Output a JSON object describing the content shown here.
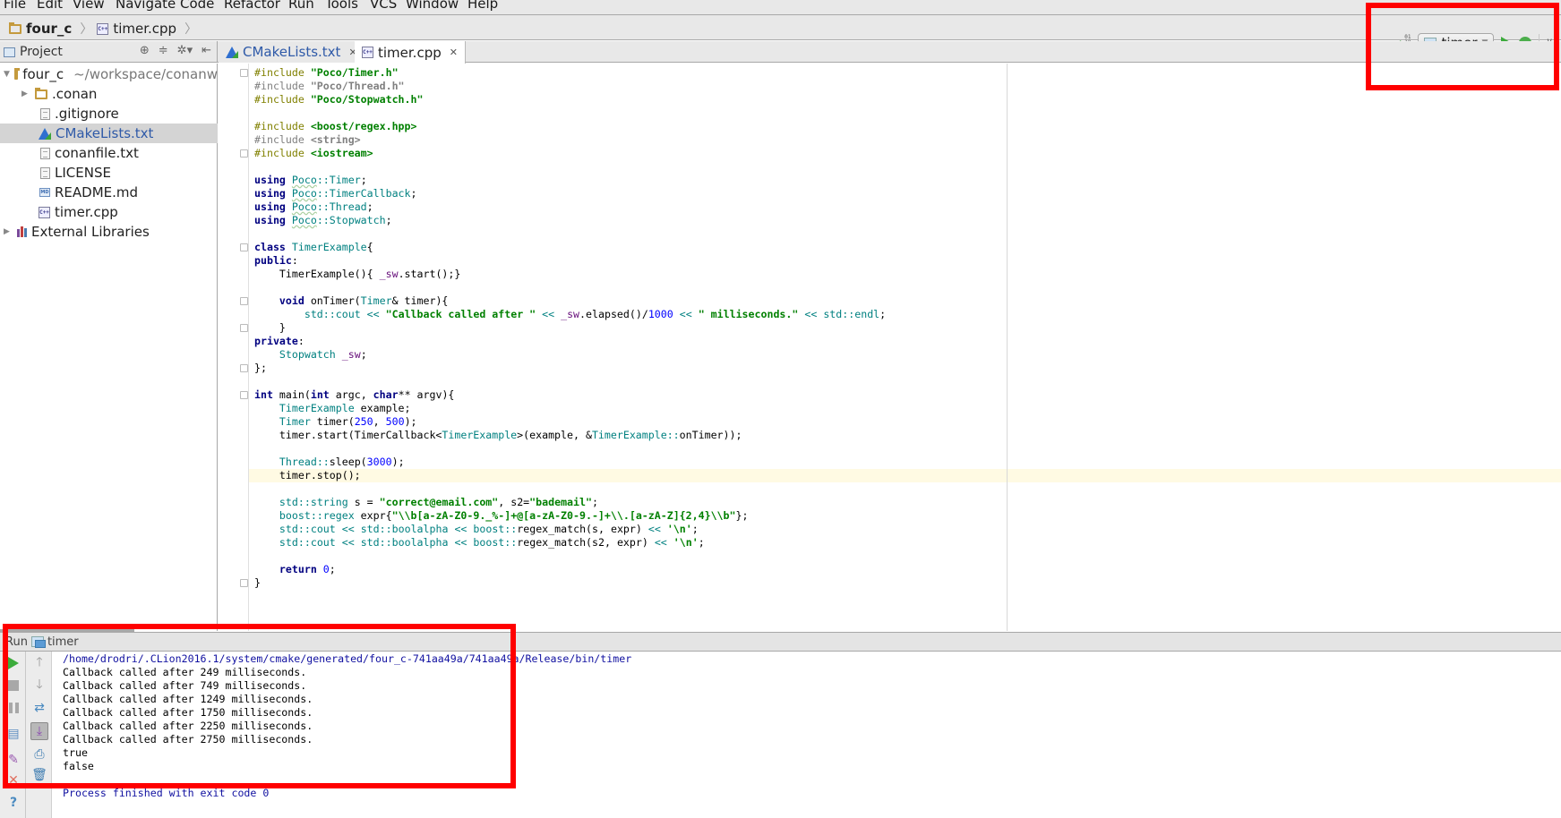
{
  "menu": [
    "File",
    "Edit",
    "View",
    "Navigate",
    "Code",
    "Refactor",
    "Run",
    "Tools",
    "VCS",
    "Window",
    "Help"
  ],
  "breadcrumb": {
    "project": "four_c",
    "file": "timer.cpp",
    "project_icon": "folder-icon",
    "file_icon": "cpp-file-icon"
  },
  "toolbar": {
    "run_config": "timer",
    "icons": [
      "sort-binary-icon",
      "run-config-icon",
      "run-icon",
      "debug-icon",
      "vcs-update-icon"
    ]
  },
  "project_panel": {
    "title": "Project",
    "tree": [
      {
        "label": "four_c",
        "hint": "~/workspace/conanw",
        "type": "folder",
        "expanded": true
      },
      {
        "label": ".conan",
        "type": "folder",
        "expanded": false
      },
      {
        "label": ".gitignore",
        "type": "text-file"
      },
      {
        "label": "CMakeLists.txt",
        "type": "cmake-file",
        "selected": true
      },
      {
        "label": "conanfile.txt",
        "type": "text-file"
      },
      {
        "label": "LICENSE",
        "type": "text-file"
      },
      {
        "label": "README.md",
        "type": "markdown-file"
      },
      {
        "label": "timer.cpp",
        "type": "cpp-file"
      },
      {
        "label": "External Libraries",
        "type": "library",
        "expanded": false
      }
    ]
  },
  "tabs": [
    {
      "label": "CMakeLists.txt",
      "active": false,
      "icon": "cmake-icon"
    },
    {
      "label": "timer.cpp",
      "active": true,
      "icon": "cpp-file-icon"
    }
  ],
  "editor": {
    "caret_line": 31,
    "lines": [
      "#include \"Poco/Timer.h\"",
      "#include \"Poco/Thread.h\"",
      "#include \"Poco/Stopwatch.h\"",
      "",
      "#include <boost/regex.hpp>",
      "#include <string>",
      "#include <iostream>",
      "",
      "using Poco::Timer;",
      "using Poco::TimerCallback;",
      "using Poco::Thread;",
      "using Poco::Stopwatch;",
      "",
      "class TimerExample{",
      "public:",
      "    TimerExample(){ _sw.start();}",
      "",
      "    void onTimer(Timer& timer){",
      "        std::cout << \"Callback called after \" << _sw.elapsed()/1000 << \" milliseconds.\" << std::endl;",
      "    }",
      "private:",
      "    Stopwatch _sw;",
      "};",
      "",
      "int main(int argc, char** argv){",
      "    TimerExample example;",
      "    Timer timer(250, 500);",
      "    timer.start(TimerCallback<TimerExample>(example, &TimerExample::onTimer));",
      "",
      "    Thread::sleep(3000);",
      "    timer.stop();",
      "",
      "    std::string s = \"correct@email.com\", s2=\"bademail\";",
      "    boost::regex expr{\"\\\\b[a-zA-Z0-9._%-]+@[a-zA-Z0-9.-]+\\\\.[a-zA-Z]{2,4}\\\\b\"};",
      "    std::cout << std::boolalpha << boost::regex_match(s, expr) << '\\n';",
      "    std::cout << std::boolalpha << boost::regex_match(s2, expr) << '\\n';",
      "",
      "    return 0;",
      "}"
    ]
  },
  "run_panel": {
    "title": "Run",
    "config": "timer",
    "output": [
      {
        "text": "/home/drodri/.CLion2016.1/system/cmake/generated/four_c-741aa49a/741aa49a/Release/bin/timer",
        "kind": "path"
      },
      {
        "text": "Callback called after 249 milliseconds.",
        "kind": "stdout"
      },
      {
        "text": "Callback called after 749 milliseconds.",
        "kind": "stdout"
      },
      {
        "text": "Callback called after 1249 milliseconds.",
        "kind": "stdout"
      },
      {
        "text": "Callback called after 1750 milliseconds.",
        "kind": "stdout"
      },
      {
        "text": "Callback called after 2250 milliseconds.",
        "kind": "stdout"
      },
      {
        "text": "Callback called after 2750 milliseconds.",
        "kind": "stdout"
      },
      {
        "text": "true",
        "kind": "stdout"
      },
      {
        "text": "false",
        "kind": "stdout"
      },
      {
        "text": "",
        "kind": "stdout"
      },
      {
        "text": "Process finished with exit code 0",
        "kind": "exit"
      }
    ],
    "left_buttons": [
      "rerun-icon",
      "stop-icon",
      "pause-icon",
      "layout-icon",
      "pin-icon",
      "close-icon",
      "help-icon"
    ],
    "right_buttons": [
      "scroll-up-icon",
      "scroll-down-icon",
      "soft-wrap-icon",
      "scroll-to-end-icon",
      "print-icon",
      "clear-icon"
    ]
  },
  "annotations": {
    "color": "#ff0000",
    "count": 2
  }
}
